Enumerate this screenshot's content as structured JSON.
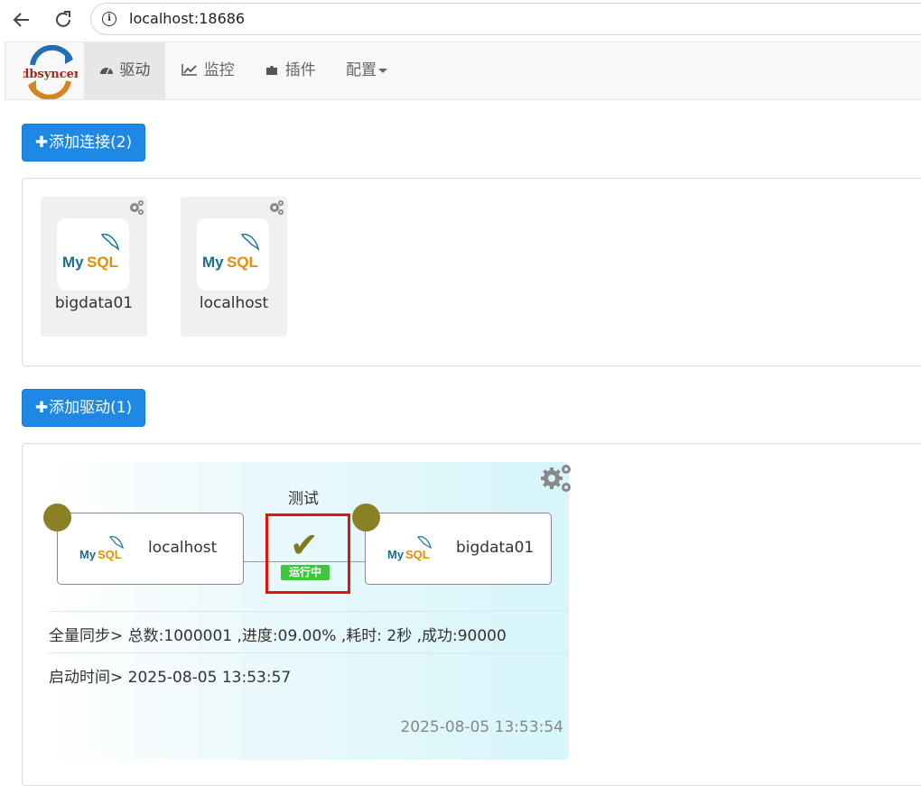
{
  "browser": {
    "url": "localhost:18686",
    "back_icon": "arrow-left-icon",
    "reload_icon": "reload-icon",
    "info_icon": "info-icon"
  },
  "navbar": {
    "brand": "dbsyncer",
    "items": [
      {
        "label": "驱动",
        "icon": "dashboard-icon",
        "active": true
      },
      {
        "label": "监控",
        "icon": "line-chart-icon",
        "active": false
      },
      {
        "label": "插件",
        "icon": "puzzle-icon",
        "active": false
      },
      {
        "label": "配置",
        "icon": "caret-down-icon",
        "active": false
      }
    ]
  },
  "connections": {
    "add_button": "添加连接(2)",
    "items": [
      {
        "name": "bigdata01",
        "type": "MySQL"
      },
      {
        "name": "localhost",
        "type": "MySQL"
      }
    ]
  },
  "drivers": {
    "add_button": "添加驱动(1)",
    "items": [
      {
        "name": "测试",
        "source": "localhost",
        "target": "bigdata01",
        "source_type": "MySQL",
        "target_type": "MySQL",
        "status_icon": "check-icon",
        "status_glyph": "✔",
        "status": "运行中",
        "full_sync": "全量同步> 总数:1000001 ,进度:09.00% ,耗时: 2秒 ,成功:90000",
        "start_time": "启动时间> 2025-08-05 13:53:57",
        "updated": "2025-08-05 13:53:54"
      }
    ]
  },
  "colors": {
    "primary": "#1e88e5",
    "status_green": "#3ec63e",
    "node_dot": "#8a8025",
    "highlight_border": "#e3120b"
  }
}
